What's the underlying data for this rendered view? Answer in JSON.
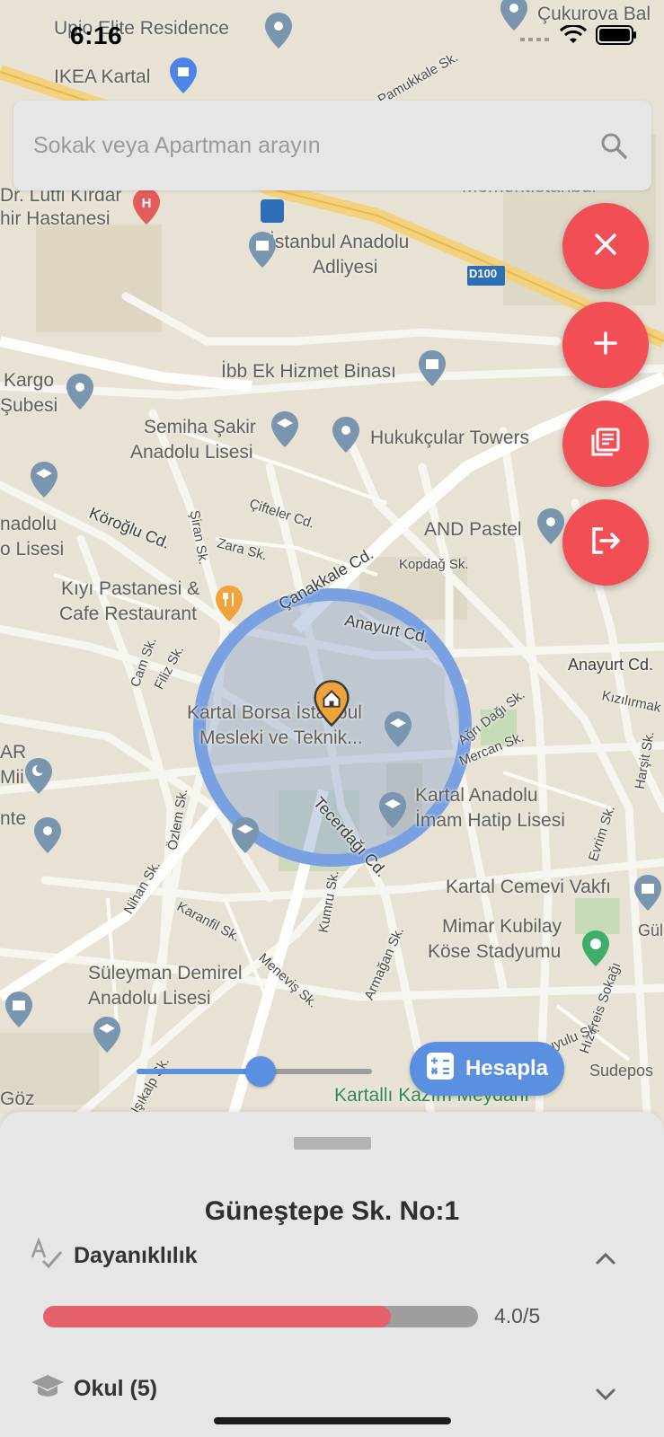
{
  "status_bar": {
    "time": "6:16"
  },
  "search": {
    "placeholder": "Sokak veya Apartman arayın"
  },
  "map": {
    "places": [
      "Upio Elite Residence",
      "Çukurova Bal",
      "IKEA Kartal",
      "Dr. Lütfi Kırdar",
      "hir Hastanesi",
      "İstanbul Anadolu",
      "Adliyesi",
      "İbb Ek Hizmet Binası",
      "Kargo",
      "Şubesi",
      "Semiha Şakir",
      "Anadolu Lisesi",
      "Hukukçular Towers",
      "nadolu",
      "o Lisesi",
      "AND Pastel",
      "Kıyı Pastanesi &",
      "Cafe Restaurant",
      "Kartal Borsa İstanbul",
      "Mesleki ve Teknik...",
      "Kartal Anadolu",
      "İmam Hatip Lisesi",
      "Kartal Cemevi Vakfı",
      "Mimar Kubilay",
      "Köse Stadyumu",
      "Süleyman Demirel",
      "Anadolu Lisesi",
      "Kartallı Kazım Meydanı",
      "Sudepos",
      "Gül",
      "AR",
      "Mii",
      "nte",
      "Göz",
      "Momentİstanbul"
    ],
    "streets": [
      "Köroğlu Cd.",
      "Çanakkale Cd.",
      "Anayurt Cd.",
      "Anayurt Cd.",
      "Tecerdağı Cd.",
      "Çifteler Cd.",
      "Zara Sk.",
      "Şiran Sk.",
      "Kopdağ Sk.",
      "Ağrı Dağı Sk.",
      "Mercan Sk.",
      "Cam Sk.",
      "Filiz Sk.",
      "Özlem Sk.",
      "Nihan Sk.",
      "Karanfil Sk.",
      "Meneviş Sk.",
      "Kumru Sk.",
      "Armağan Sk.",
      "Kızılırmak",
      "Evrim Sk.",
      "Hızırreis Sokağı",
      "Kuyulu Sk.",
      "Harşit Sk.",
      "Pamukkale Sk.",
      "Işıkalp Sk.",
      "D100"
    ],
    "radius_fraction": 0.53
  },
  "fabs": {
    "close": "close-icon",
    "add": "add-icon",
    "list": "library-books-icon",
    "logout": "logout-icon"
  },
  "actions": {
    "calculate_label": "Hesapla"
  },
  "sheet": {
    "address": "Güneştepe Sk. No:1",
    "sections": [
      {
        "label": "Dayanıklılık",
        "icon": "spellcheck-icon",
        "value": "4.0/5",
        "rating": 0.8,
        "expanded": true
      },
      {
        "label": "Okul (5)",
        "icon": "school-icon",
        "expanded": false
      }
    ]
  },
  "colors": {
    "accent_red": "#f24e55",
    "accent_blue": "#5b8fe0",
    "bar_red": "#e5616b"
  }
}
